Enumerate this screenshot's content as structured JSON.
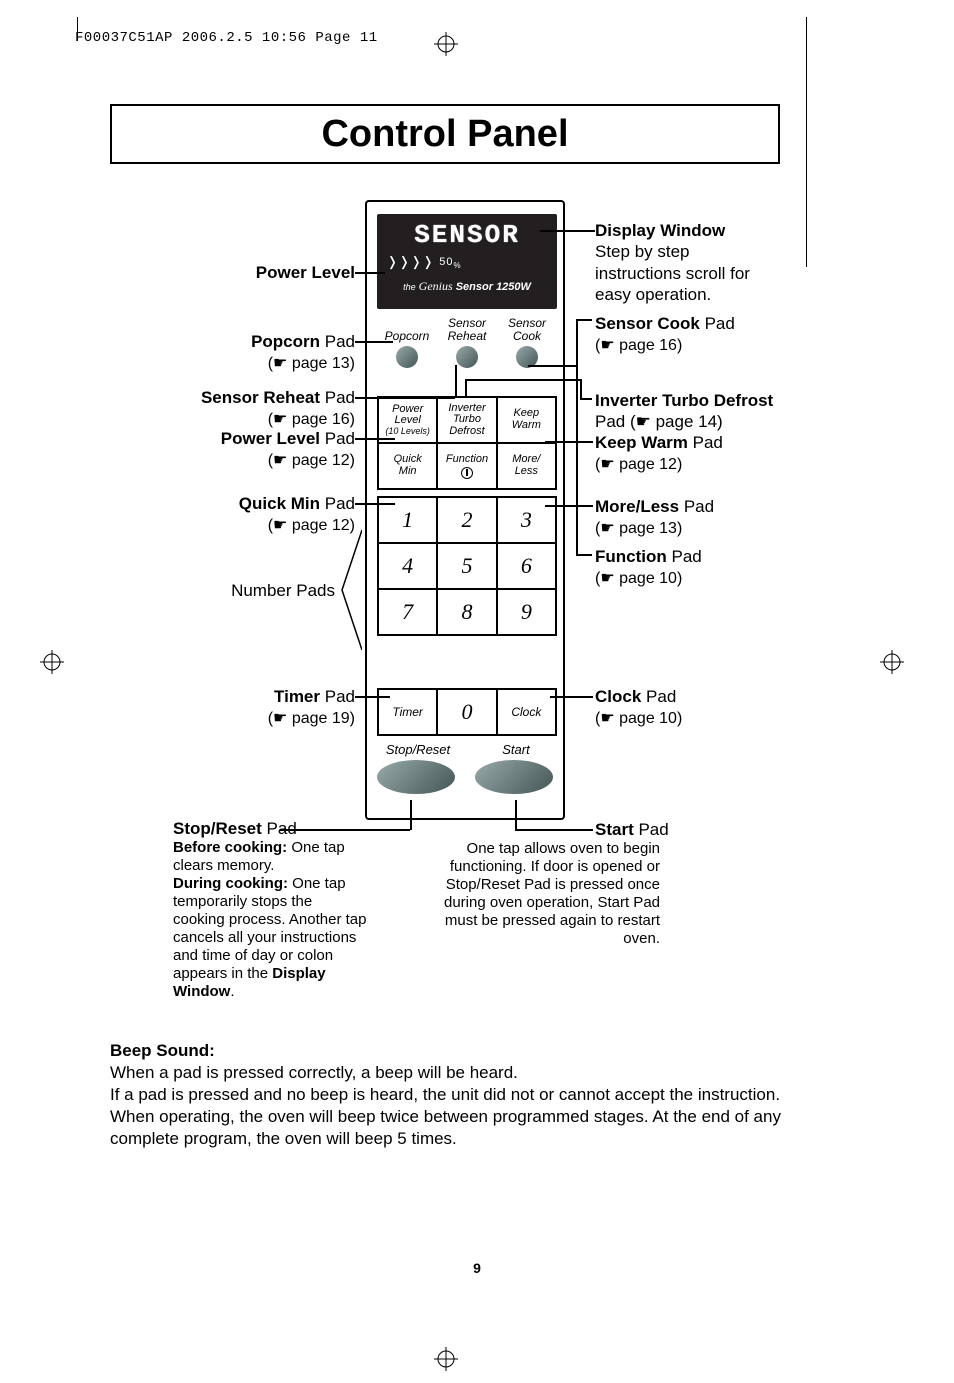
{
  "header": "F00037C51AP  2006.2.5  10:56  Page 11",
  "title": "Control Panel",
  "display": {
    "word": "SENSOR",
    "pl_glyphs": "❭❭❭❭",
    "pl_value": "50",
    "pl_unit": "%",
    "genius_the": "the",
    "genius_script": "Genius",
    "genius_rest": "Sensor 1250W"
  },
  "sensor_row": [
    {
      "l1": "",
      "l2": "Popcorn"
    },
    {
      "l1": "Sensor",
      "l2": "Reheat"
    },
    {
      "l1": "Sensor",
      "l2": "Cook"
    }
  ],
  "func_grid": [
    [
      {
        "l1": "Power",
        "l2": "Level",
        "sub": "(10 Levels)"
      },
      {
        "l1": "Inverter",
        "l2": "Turbo",
        "l3": "Defrost"
      },
      {
        "l1": "Keep",
        "l2": "Warm"
      }
    ],
    [
      {
        "l1": "Quick",
        "l2": "Min"
      },
      {
        "l1": "Function",
        "icon": true
      },
      {
        "l1": "More/",
        "l2": "Less"
      }
    ]
  ],
  "num_grid": [
    [
      "1",
      "2",
      "3"
    ],
    [
      "4",
      "5",
      "6"
    ],
    [
      "7",
      "8",
      "9"
    ]
  ],
  "timer_row": [
    "Timer",
    "0",
    "Clock"
  ],
  "big_buttons": {
    "stop": "Stop/Reset",
    "start": "Start"
  },
  "labels": {
    "power_level": "Power Level",
    "popcorn": {
      "name": "Popcorn",
      "suffix": " Pad",
      "ref": "(☛ page 13)"
    },
    "sensor_reheat": {
      "name": "Sensor Reheat",
      "suffix": " Pad",
      "ref": "(☛ page 16)"
    },
    "power_level_pad": {
      "name": "Power Level",
      "suffix": " Pad",
      "ref": "(☛ page 12)"
    },
    "quick_min": {
      "name": "Quick Min",
      "suffix": " Pad",
      "ref": "(☛ page 12)"
    },
    "number_pads": "Number Pads",
    "timer": {
      "name": "Timer",
      "suffix": " Pad",
      "ref": "(☛ page 19)"
    },
    "display_window": {
      "name": "Display Window",
      "desc": "Step by step instructions scroll for easy operation."
    },
    "sensor_cook": {
      "name": "Sensor Cook",
      "suffix": " Pad",
      "ref": "(☛ page 16)"
    },
    "inverter_turbo": {
      "name": "Inverter Turbo Defrost",
      "desc": "Pad (☛ page 14)"
    },
    "keep_warm": {
      "name": "Keep Warm",
      "suffix": " Pad",
      "ref": "(☛ page 12)"
    },
    "more_less": {
      "name": "More/Less",
      "suffix": " Pad",
      "ref": "(☛ page 13)"
    },
    "function": {
      "name": "Function",
      "suffix": " Pad",
      "ref": "(☛ page 10)"
    },
    "clock": {
      "name": "Clock",
      "suffix": " Pad",
      "ref": "(☛ page 10)"
    },
    "start": {
      "name": "Start",
      "suffix": " Pad"
    },
    "stop_reset": {
      "name": "Stop/Reset",
      "suffix": " Pad"
    }
  },
  "stop_reset_note": {
    "before_label": "Before cooking:",
    "before_text": " One tap clears memory.",
    "during_label": "During cooking:",
    "during_text": " One tap temporarily stops the cooking process. Another tap cancels all your instructions and time of day or colon appears in the ",
    "tail_bold": "Display Window",
    "tail": "."
  },
  "start_note": {
    "l1": "One tap allows oven to begin functioning. If door is opened or ",
    "sr": "Stop/Reset",
    "l2": " Pad is pressed once during oven operation, ",
    "st": "Start",
    "l3": " Pad must be pressed again to restart oven."
  },
  "beep": {
    "title": "Beep Sound:",
    "text": "When a pad is pressed correctly, a beep will be heard.\nIf a pad is pressed and no beep is heard, the unit did not or cannot accept the instruction. When operating, the oven will beep twice between programmed stages. At the end of any complete program, the oven will beep 5 times."
  },
  "page_number": "9"
}
